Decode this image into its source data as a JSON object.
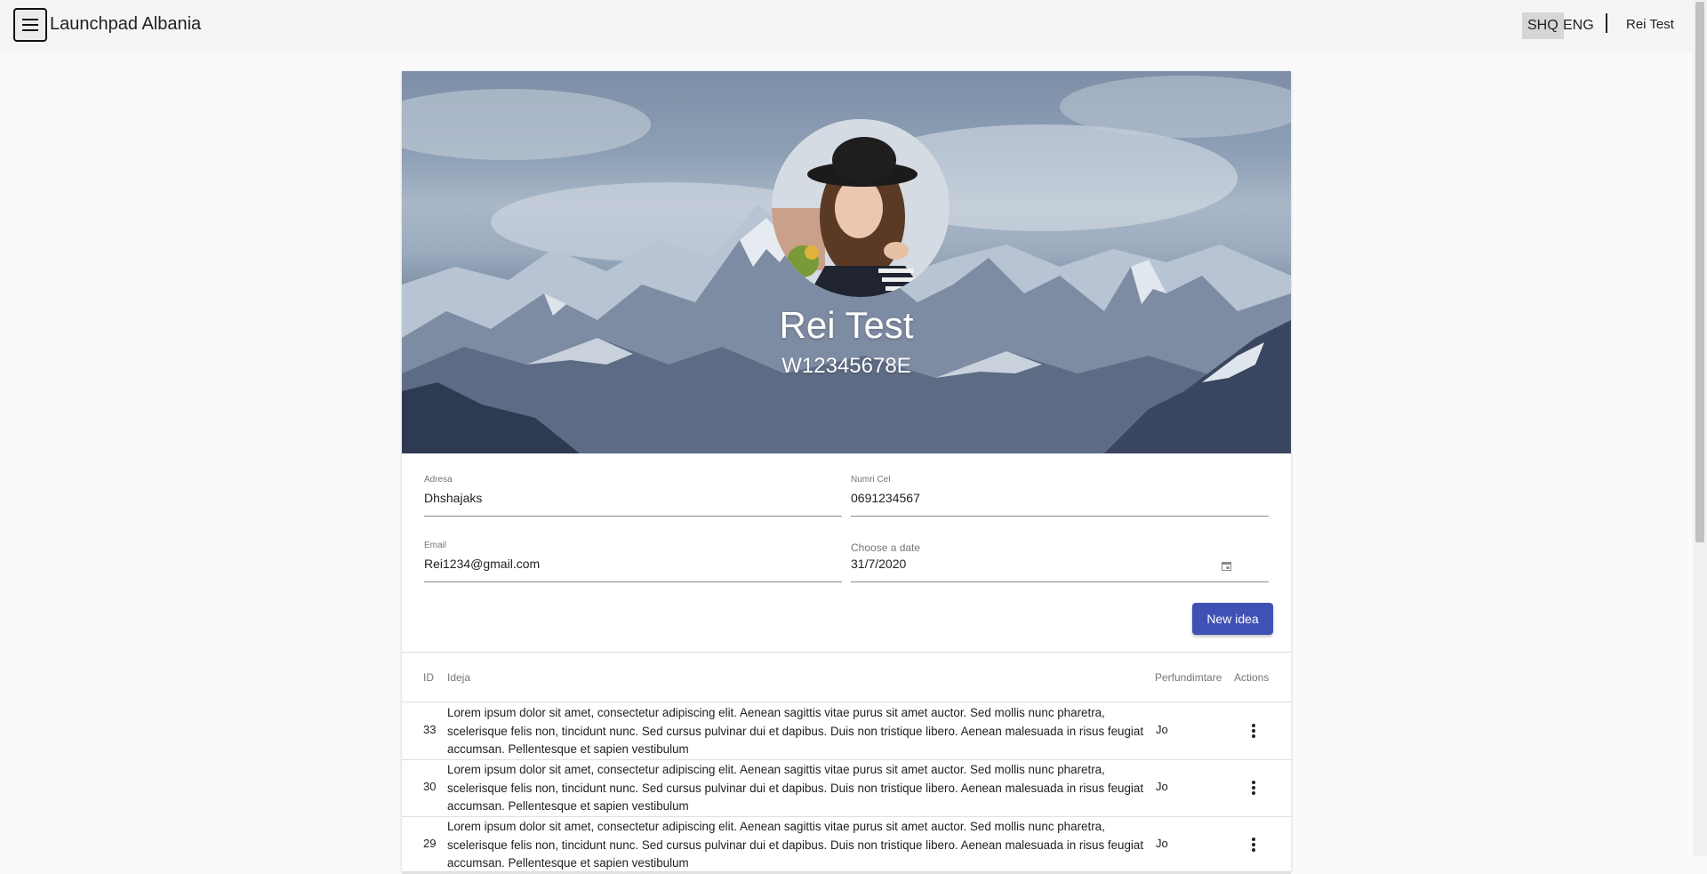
{
  "app": {
    "title": "Launchpad Albania"
  },
  "header": {
    "languages": [
      "SHQ",
      "ENG"
    ],
    "active_language": "SHQ",
    "user": "Rei Test"
  },
  "profile": {
    "name": "Rei Test",
    "id_number": "W12345678E",
    "fields": {
      "address": {
        "label": "Adresa",
        "value": "Dhshajaks"
      },
      "phone": {
        "label": "Numri Cel",
        "value": "0691234567"
      },
      "email": {
        "label": "Email",
        "value": "Rei1234@gmail.com"
      },
      "date": {
        "label": "Choose a date",
        "value": "31/7/2020"
      }
    },
    "new_idea_label": "New idea"
  },
  "table": {
    "headers": {
      "id": "ID",
      "idea": "Ideja",
      "done": "Perfundimtare",
      "actions": "Actions"
    },
    "rows": [
      {
        "id": "33",
        "idea": "Lorem ipsum dolor sit amet, consectetur adipiscing elit. Aenean sagittis vitae purus sit amet auctor. Sed mollis nunc pharetra, scelerisque felis non, tincidunt nunc. Sed cursus pulvinar dui et dapibus. Duis non tristique libero. Aenean malesuada in risus feugiat accumsan. Pellentesque et sapien vestibulum",
        "done": "Jo"
      },
      {
        "id": "30",
        "idea": "Lorem ipsum dolor sit amet, consectetur adipiscing elit. Aenean sagittis vitae purus sit amet auctor. Sed mollis nunc pharetra, scelerisque felis non, tincidunt nunc. Sed cursus pulvinar dui et dapibus. Duis non tristique libero. Aenean malesuada in risus feugiat accumsan. Pellentesque et sapien vestibulum",
        "done": "Jo"
      },
      {
        "id": "29",
        "idea": "Lorem ipsum dolor sit amet, consectetur adipiscing elit. Aenean sagittis vitae purus sit amet auctor. Sed mollis nunc pharetra, scelerisque felis non, tincidunt nunc. Sed cursus pulvinar dui et dapibus. Duis non tristique libero. Aenean malesuada in risus feugiat accumsan. Pellentesque et sapien vestibulum",
        "done": "Jo"
      }
    ]
  },
  "icons": {
    "menu": "menu-icon",
    "calendar": "calendar-icon",
    "more": "more-vert-icon"
  },
  "colors": {
    "primary": "#3f51b5"
  }
}
